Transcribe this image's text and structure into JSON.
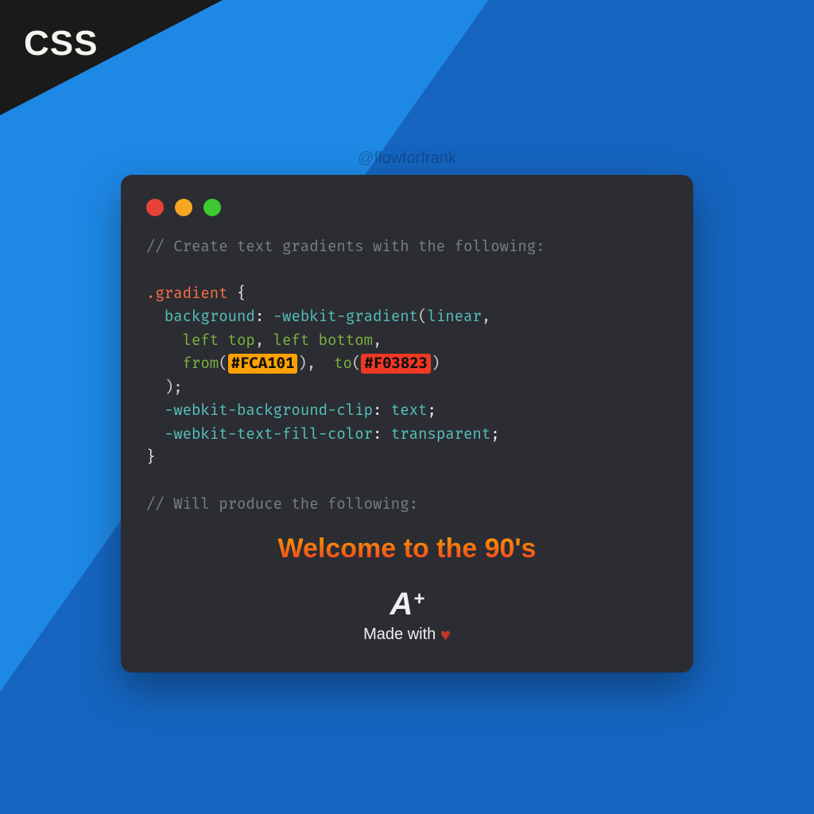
{
  "badge": "CSS",
  "watermark": "@flowforfrank",
  "code": {
    "comment1": "// Create text gradients with the following:",
    "selector": ".gradient",
    "prop_background": "background",
    "val_gradient_fn": "-webkit-gradient",
    "val_linear": "linear",
    "val_left_top": "left top",
    "val_left_bottom": "left bottom",
    "fn_from": "from",
    "color_from": "#FCA101",
    "fn_to": "to",
    "color_to": "#F03823",
    "prop_bgclip": "-webkit-background-clip",
    "val_bgclip": "text",
    "prop_fill": "-webkit-text-fill-color",
    "val_fill": "transparent",
    "comment2": "// Will produce the following:"
  },
  "result_text": "Welcome to the 90's",
  "logo": {
    "mark_letter": "A",
    "mark_plus": "+",
    "made_with": "Made with",
    "heart": "♥"
  },
  "colors": {
    "gradient_from": "#FCA101",
    "gradient_to": "#F03823"
  }
}
